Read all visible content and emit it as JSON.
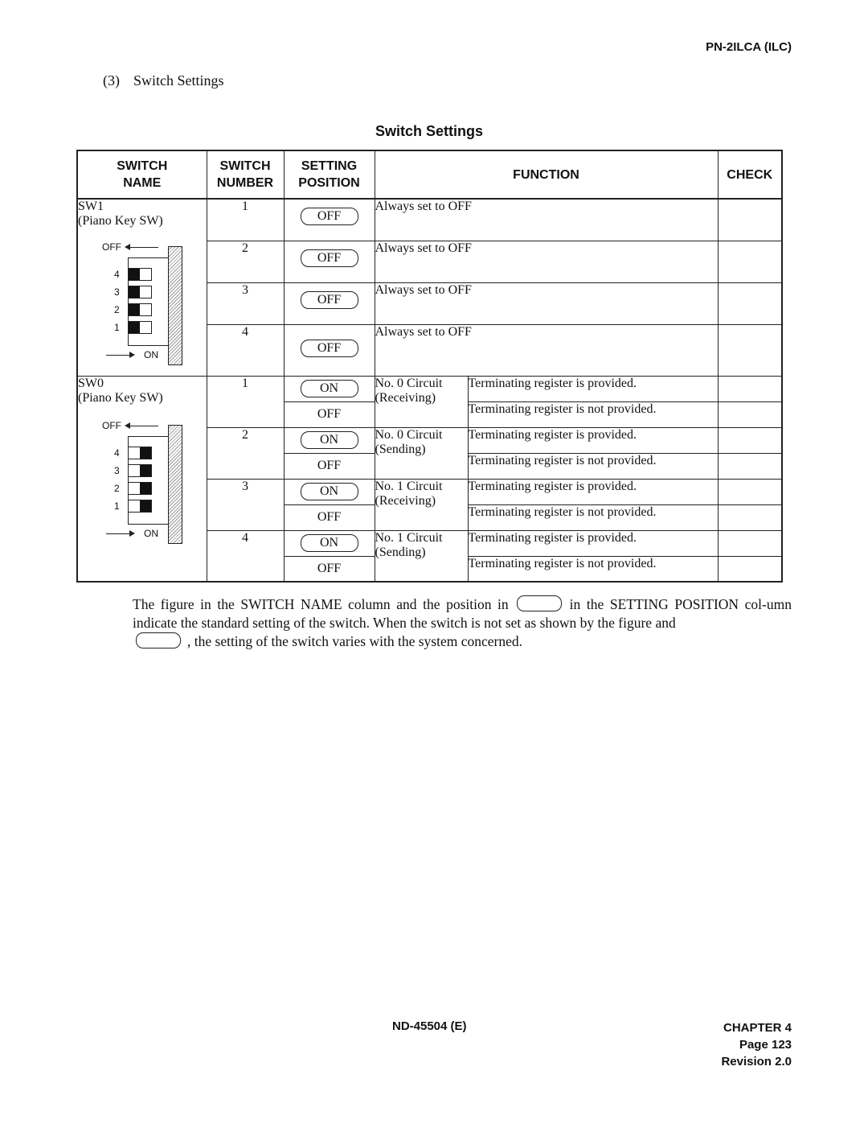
{
  "header": {
    "doc_code": "PN-2ILCA (ILC)"
  },
  "section": {
    "number": "(3)",
    "title": "Switch Settings"
  },
  "table": {
    "title": "Switch Settings",
    "columns": {
      "switch_name": [
        "SWITCH",
        "NAME"
      ],
      "switch_number": [
        "SWITCH",
        "NUMBER"
      ],
      "setting_position": [
        "SETTING",
        "POSITION"
      ],
      "function": "FUNCTION",
      "check": "CHECK"
    },
    "groups": [
      {
        "name": "SW1",
        "type": "(Piano Key SW)",
        "figure": {
          "off_label": "OFF",
          "on_label": "ON",
          "keys": [
            {
              "label": "4",
              "state": "OFF"
            },
            {
              "label": "3",
              "state": "OFF"
            },
            {
              "label": "2",
              "state": "OFF"
            },
            {
              "label": "1",
              "state": "OFF"
            }
          ]
        },
        "rows": [
          {
            "number": "1",
            "position": "OFF",
            "function": "Always set to OFF",
            "check": ""
          },
          {
            "number": "2",
            "position": "OFF",
            "function": "Always set to OFF",
            "check": ""
          },
          {
            "number": "3",
            "position": "OFF",
            "function": "Always set to OFF",
            "check": ""
          },
          {
            "number": "4",
            "position": "OFF",
            "function": "Always set to OFF",
            "check": ""
          }
        ]
      },
      {
        "name": "SW0",
        "type": "(Piano Key SW)",
        "figure": {
          "off_label": "OFF",
          "on_label": "ON",
          "keys": [
            {
              "label": "4",
              "state": "ON"
            },
            {
              "label": "3",
              "state": "ON"
            },
            {
              "label": "2",
              "state": "ON"
            },
            {
              "label": "1",
              "state": "ON"
            }
          ]
        },
        "rows": [
          {
            "number": "1",
            "circuit": "No. 0 Circuit",
            "direction": "(Receiving)",
            "options": [
              {
                "position": "ON",
                "standard": true,
                "function": "Terminating register is provided.",
                "check": ""
              },
              {
                "position": "OFF",
                "standard": false,
                "function": "Terminating register is not provided.",
                "check": ""
              }
            ]
          },
          {
            "number": "2",
            "circuit": "No. 0 Circuit",
            "direction": "(Sending)",
            "options": [
              {
                "position": "ON",
                "standard": true,
                "function": "Terminating register is provided.",
                "check": ""
              },
              {
                "position": "OFF",
                "standard": false,
                "function": "Terminating register is not provided.",
                "check": ""
              }
            ]
          },
          {
            "number": "3",
            "circuit": "No. 1 Circuit",
            "direction": "(Receiving)",
            "options": [
              {
                "position": "ON",
                "standard": true,
                "function": "Terminating register is provided.",
                "check": ""
              },
              {
                "position": "OFF",
                "standard": false,
                "function": "Terminating register is not provided.",
                "check": ""
              }
            ]
          },
          {
            "number": "4",
            "circuit": "No. 1 Circuit",
            "direction": "(Sending)",
            "options": [
              {
                "position": "ON",
                "standard": true,
                "function": "Terminating register is provided.",
                "check": ""
              },
              {
                "position": "OFF",
                "standard": false,
                "function": "Terminating register is not provided.",
                "check": ""
              }
            ]
          }
        ]
      }
    ]
  },
  "note": {
    "part1": "The figure in the SWITCH NAME column and the position in",
    "part2": "in the SETTING POSITION col-umn indicate the standard setting of the switch. When the switch is not set as shown by the figure and",
    "part3": ", the setting of the switch varies with the system concerned."
  },
  "footer": {
    "doc_number": "ND-45504 (E)",
    "chapter": "CHAPTER 4",
    "page": "Page 123",
    "revision": "Revision 2.0"
  }
}
